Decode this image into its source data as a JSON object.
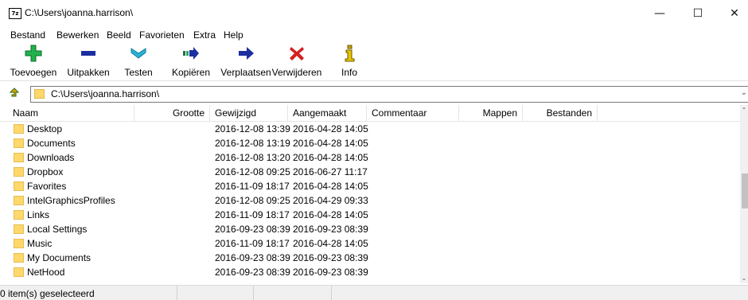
{
  "window": {
    "title": "C:\\Users\\joanna.harrison\\",
    "app_icon_text": "7z"
  },
  "menu": [
    "Bestand",
    "Bewerken",
    "Beeld",
    "Favorieten",
    "Extra",
    "Help"
  ],
  "toolbar": {
    "buttons": [
      {
        "label": "Toevoegen",
        "icon": "add-icon",
        "color": "#21b24b"
      },
      {
        "label": "Uitpakken",
        "icon": "extract-icon",
        "color": "#1b2fa0"
      },
      {
        "label": "Testen",
        "icon": "test-icon",
        "color": "#2ab3d6"
      },
      {
        "label": "Kopiëren",
        "icon": "copy-icon",
        "color": "#27a86b"
      },
      {
        "label": "Verplaatsen",
        "icon": "move-icon",
        "color": "#1b2fa0"
      },
      {
        "label": "Verwijderen",
        "icon": "delete-icon",
        "color": "#d42020"
      },
      {
        "label": "Info",
        "icon": "info-icon",
        "color": "#c8a400"
      }
    ]
  },
  "address": {
    "path": "C:\\Users\\joanna.harrison\\"
  },
  "columns": [
    "Naam",
    "Grootte",
    "Gewijzigd",
    "Aangemaakt",
    "Commentaar",
    "Mappen",
    "Bestanden"
  ],
  "rows": [
    {
      "name": "Desktop",
      "modified": "2016-12-08 13:39",
      "created": "2016-04-28 14:05"
    },
    {
      "name": "Documents",
      "modified": "2016-12-08 13:19",
      "created": "2016-04-28 14:05"
    },
    {
      "name": "Downloads",
      "modified": "2016-12-08 13:20",
      "created": "2016-04-28 14:05"
    },
    {
      "name": "Dropbox",
      "modified": "2016-12-08 09:25",
      "created": "2016-06-27 11:17"
    },
    {
      "name": "Favorites",
      "modified": "2016-11-09 18:17",
      "created": "2016-04-28 14:05"
    },
    {
      "name": "IntelGraphicsProfiles",
      "modified": "2016-12-08 09:25",
      "created": "2016-04-29 09:33"
    },
    {
      "name": "Links",
      "modified": "2016-11-09 18:17",
      "created": "2016-04-28 14:05"
    },
    {
      "name": "Local Settings",
      "modified": "2016-09-23 08:39",
      "created": "2016-09-23 08:39"
    },
    {
      "name": "Music",
      "modified": "2016-11-09 18:17",
      "created": "2016-04-28 14:05"
    },
    {
      "name": "My Documents",
      "modified": "2016-09-23 08:39",
      "created": "2016-09-23 08:39"
    },
    {
      "name": "NetHood",
      "modified": "2016-09-23 08:39",
      "created": "2016-09-23 08:39"
    }
  ],
  "status": {
    "text": "0 item(s) geselecteerd"
  }
}
